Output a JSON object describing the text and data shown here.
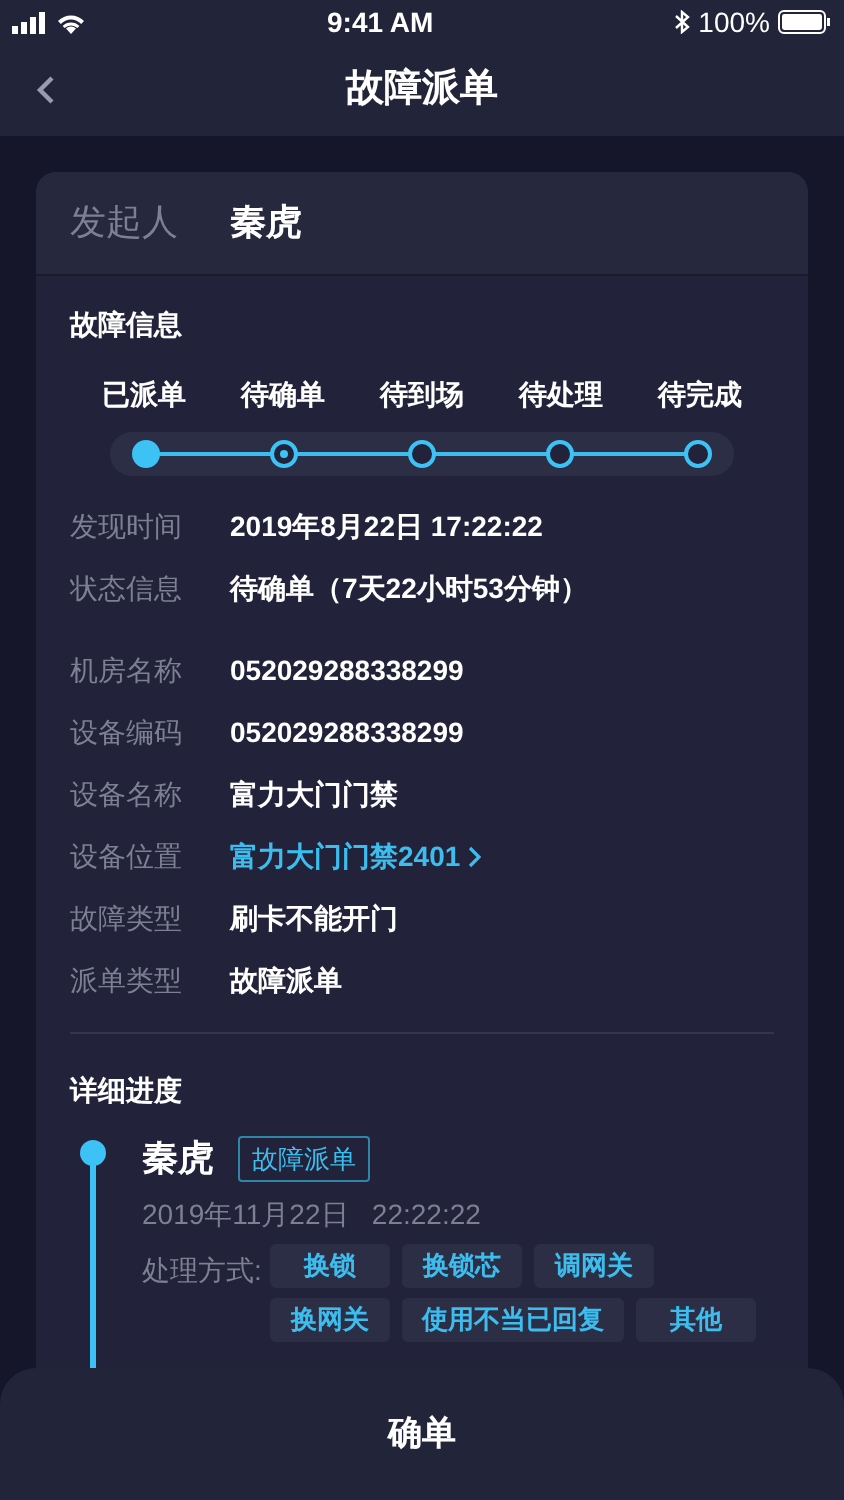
{
  "status_bar": {
    "time": "9:41 AM",
    "battery": "100%"
  },
  "nav": {
    "title": "故障派单"
  },
  "initiator": {
    "label": "发起人",
    "value": "秦虎"
  },
  "fault_info": {
    "title": "故障信息",
    "steps": [
      {
        "label": "已派单",
        "kind": "done"
      },
      {
        "label": "待确单",
        "kind": "current"
      },
      {
        "label": "待到场",
        "kind": "pending"
      },
      {
        "label": "待处理",
        "kind": "pending"
      },
      {
        "label": "待完成",
        "kind": "pending"
      }
    ],
    "groups": [
      [
        {
          "label": "发现时间",
          "value": "2019年8月22日 17:22:22",
          "kind": "text"
        },
        {
          "label": "状态信息",
          "value": "待确单（7天22小时53分钟）",
          "kind": "text"
        }
      ],
      [
        {
          "label": "机房名称",
          "value": "052029288338299",
          "kind": "text"
        },
        {
          "label": "设备编码",
          "value": "052029288338299",
          "kind": "text"
        },
        {
          "label": "设备名称",
          "value": "富力大门门禁",
          "kind": "text"
        },
        {
          "label": "设备位置",
          "value": "富力大门门禁2401",
          "kind": "link"
        },
        {
          "label": "故障类型",
          "value": "刷卡不能开门",
          "kind": "text"
        },
        {
          "label": "派单类型",
          "value": "故障派单",
          "kind": "text"
        }
      ]
    ]
  },
  "progress": {
    "title": "详细进度",
    "entries": [
      {
        "name": "秦虎",
        "tag": "故障派单",
        "time": "2019年11月22日   22:22:22",
        "methods_label": "处理方式:",
        "methods": [
          "换锁",
          "换锁芯",
          "调网关",
          "换网关",
          "使用不当已回复",
          "其他"
        ]
      }
    ]
  },
  "confirm_button": "确单"
}
